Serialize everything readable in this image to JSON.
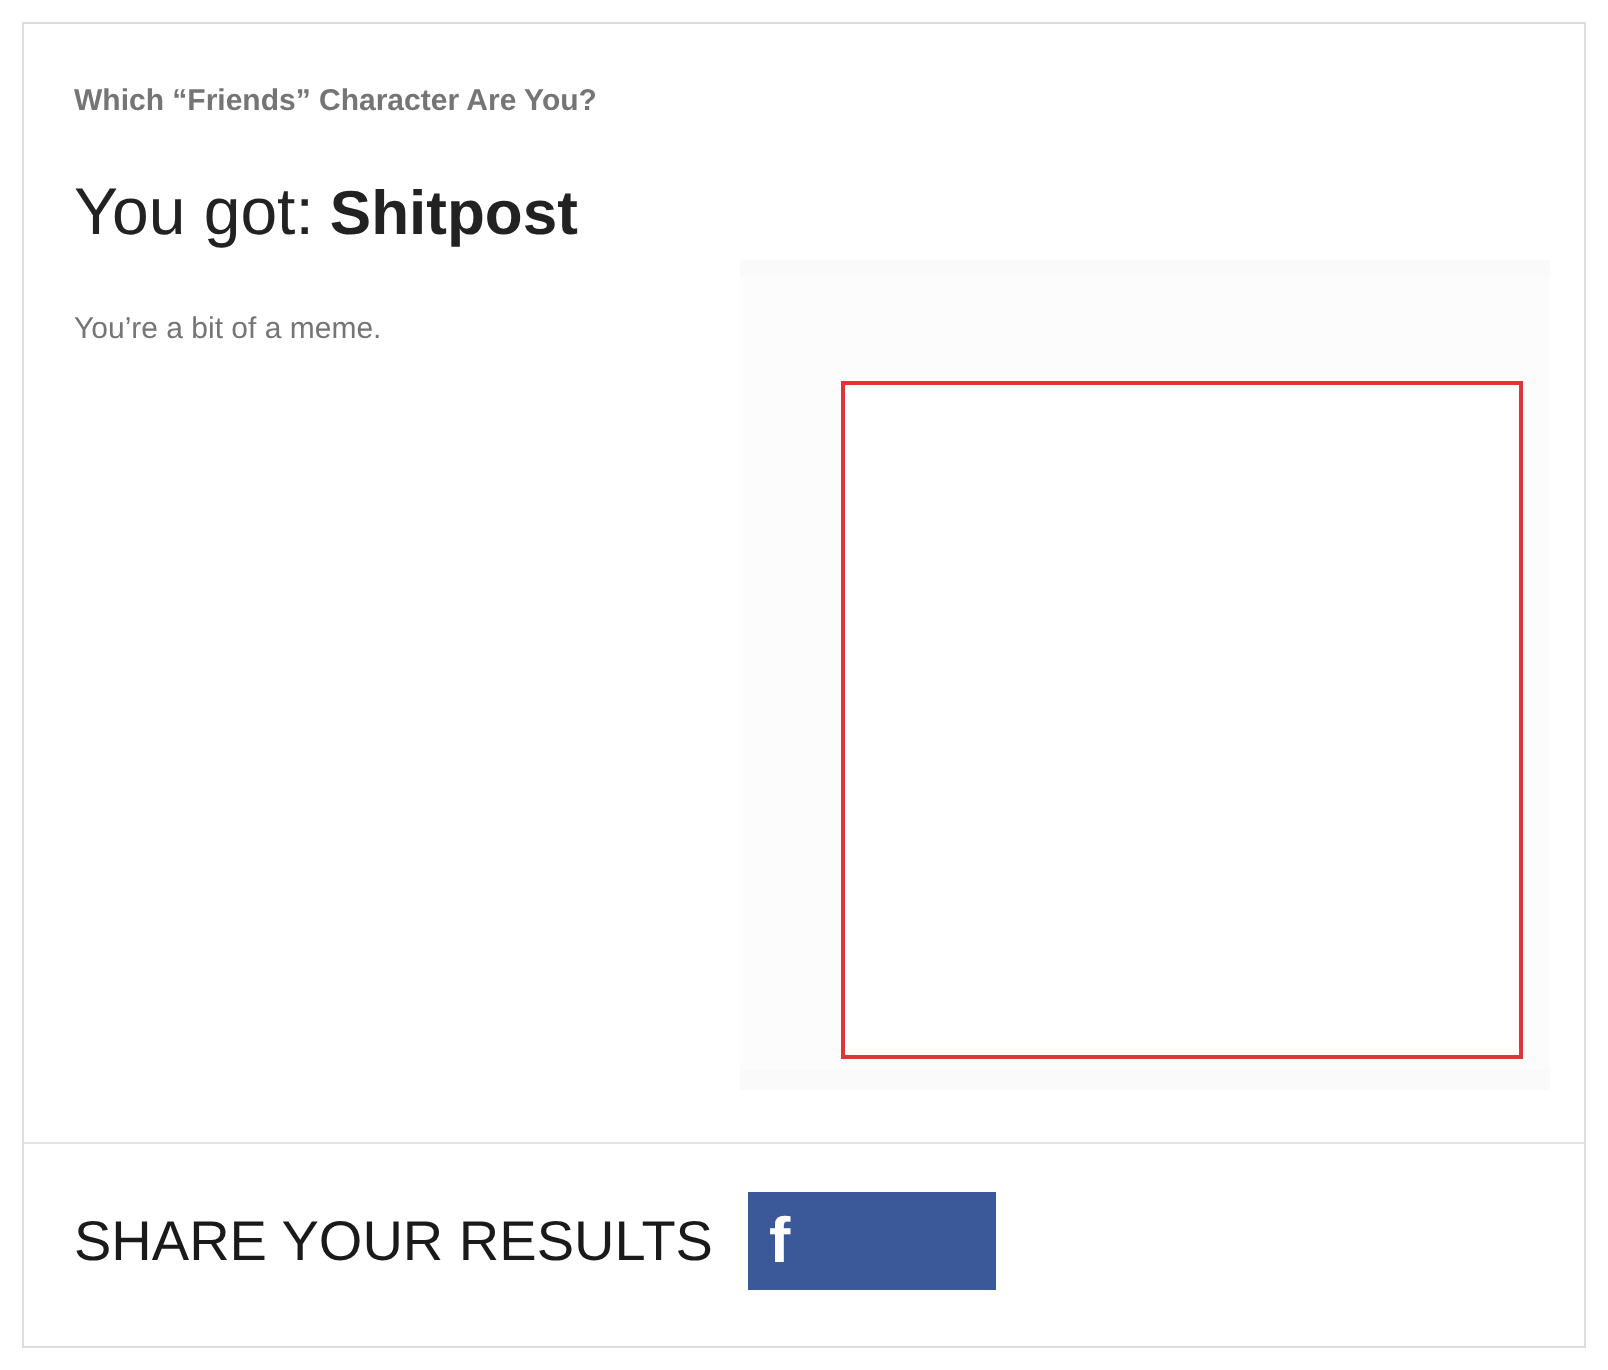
{
  "quiz_title": "Which “Friends” Character Are You?",
  "result": {
    "prefix": "You got:",
    "name": "Shitpost",
    "description": "You’re a bit of a meme."
  },
  "share": {
    "heading": "SHARE YOUR RESULTS",
    "buttons": [
      {
        "kind": "facebook",
        "icon": "f"
      }
    ]
  }
}
